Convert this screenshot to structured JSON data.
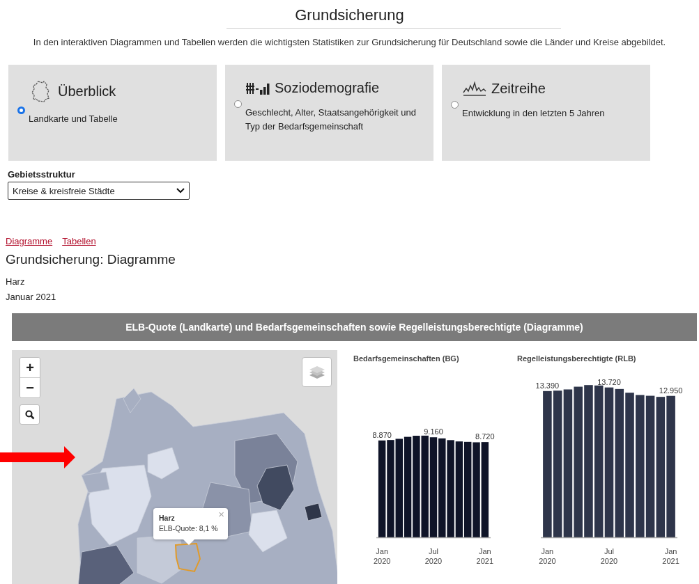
{
  "page": {
    "title": "Grundsicherung",
    "intro": "In den interaktiven Diagrammen und Tabellen werden die wichtigsten Statistiken zur Grundsicherung für Deutschland sowie die Länder und Kreise abgebildet."
  },
  "views": [
    {
      "kind": "map",
      "title": "Überblick",
      "description": "Landkarte und Tabelle",
      "selected": true
    },
    {
      "kind": "bars",
      "title": "Soziodemografie",
      "description": "Geschlecht, Alter, Staatsangehörigkeit und Typ der Bedarfsgemeinschaft",
      "selected": false
    },
    {
      "kind": "line",
      "title": "Zeitreihe",
      "description": "Entwicklung in den letzten 5 Jahren",
      "selected": false
    }
  ],
  "region_filter": {
    "label": "Gebietsstruktur",
    "value": "Kreise & kreisfreie Städte"
  },
  "links": [
    {
      "label": "Diagramme"
    },
    {
      "label": "Tabellen"
    }
  ],
  "section": {
    "title": "Grundsicherung: Diagramme",
    "region": "Harz",
    "period": "Januar 2021"
  },
  "panel": {
    "title": "ELB-Quote (Landkarte) und Bedarfsgemeinschaften sowie Regelleistungsberechtigte (Diagramme)",
    "map": {
      "zoom_in": "+",
      "zoom_out": "−",
      "popup": {
        "title": "Harz",
        "text": "ELB-Quote: 8,1 %",
        "close": "×"
      }
    },
    "charts": [
      {
        "title": "Bedarfsgemeinschaften (BG)",
        "bar_labels": [
          "8.870",
          "9.160",
          "8.720"
        ],
        "axis_labels": [
          "Jan 2020",
          "Jul 2020",
          "Jan 2021"
        ]
      },
      {
        "title": "Regelleistungsberechtigte (RLB)",
        "bar_labels": [
          "13.390",
          "13.720",
          "12.950"
        ],
        "axis_labels": [
          "Jan 2020",
          "Jul 2020",
          "Jan 2021"
        ]
      }
    ]
  }
}
